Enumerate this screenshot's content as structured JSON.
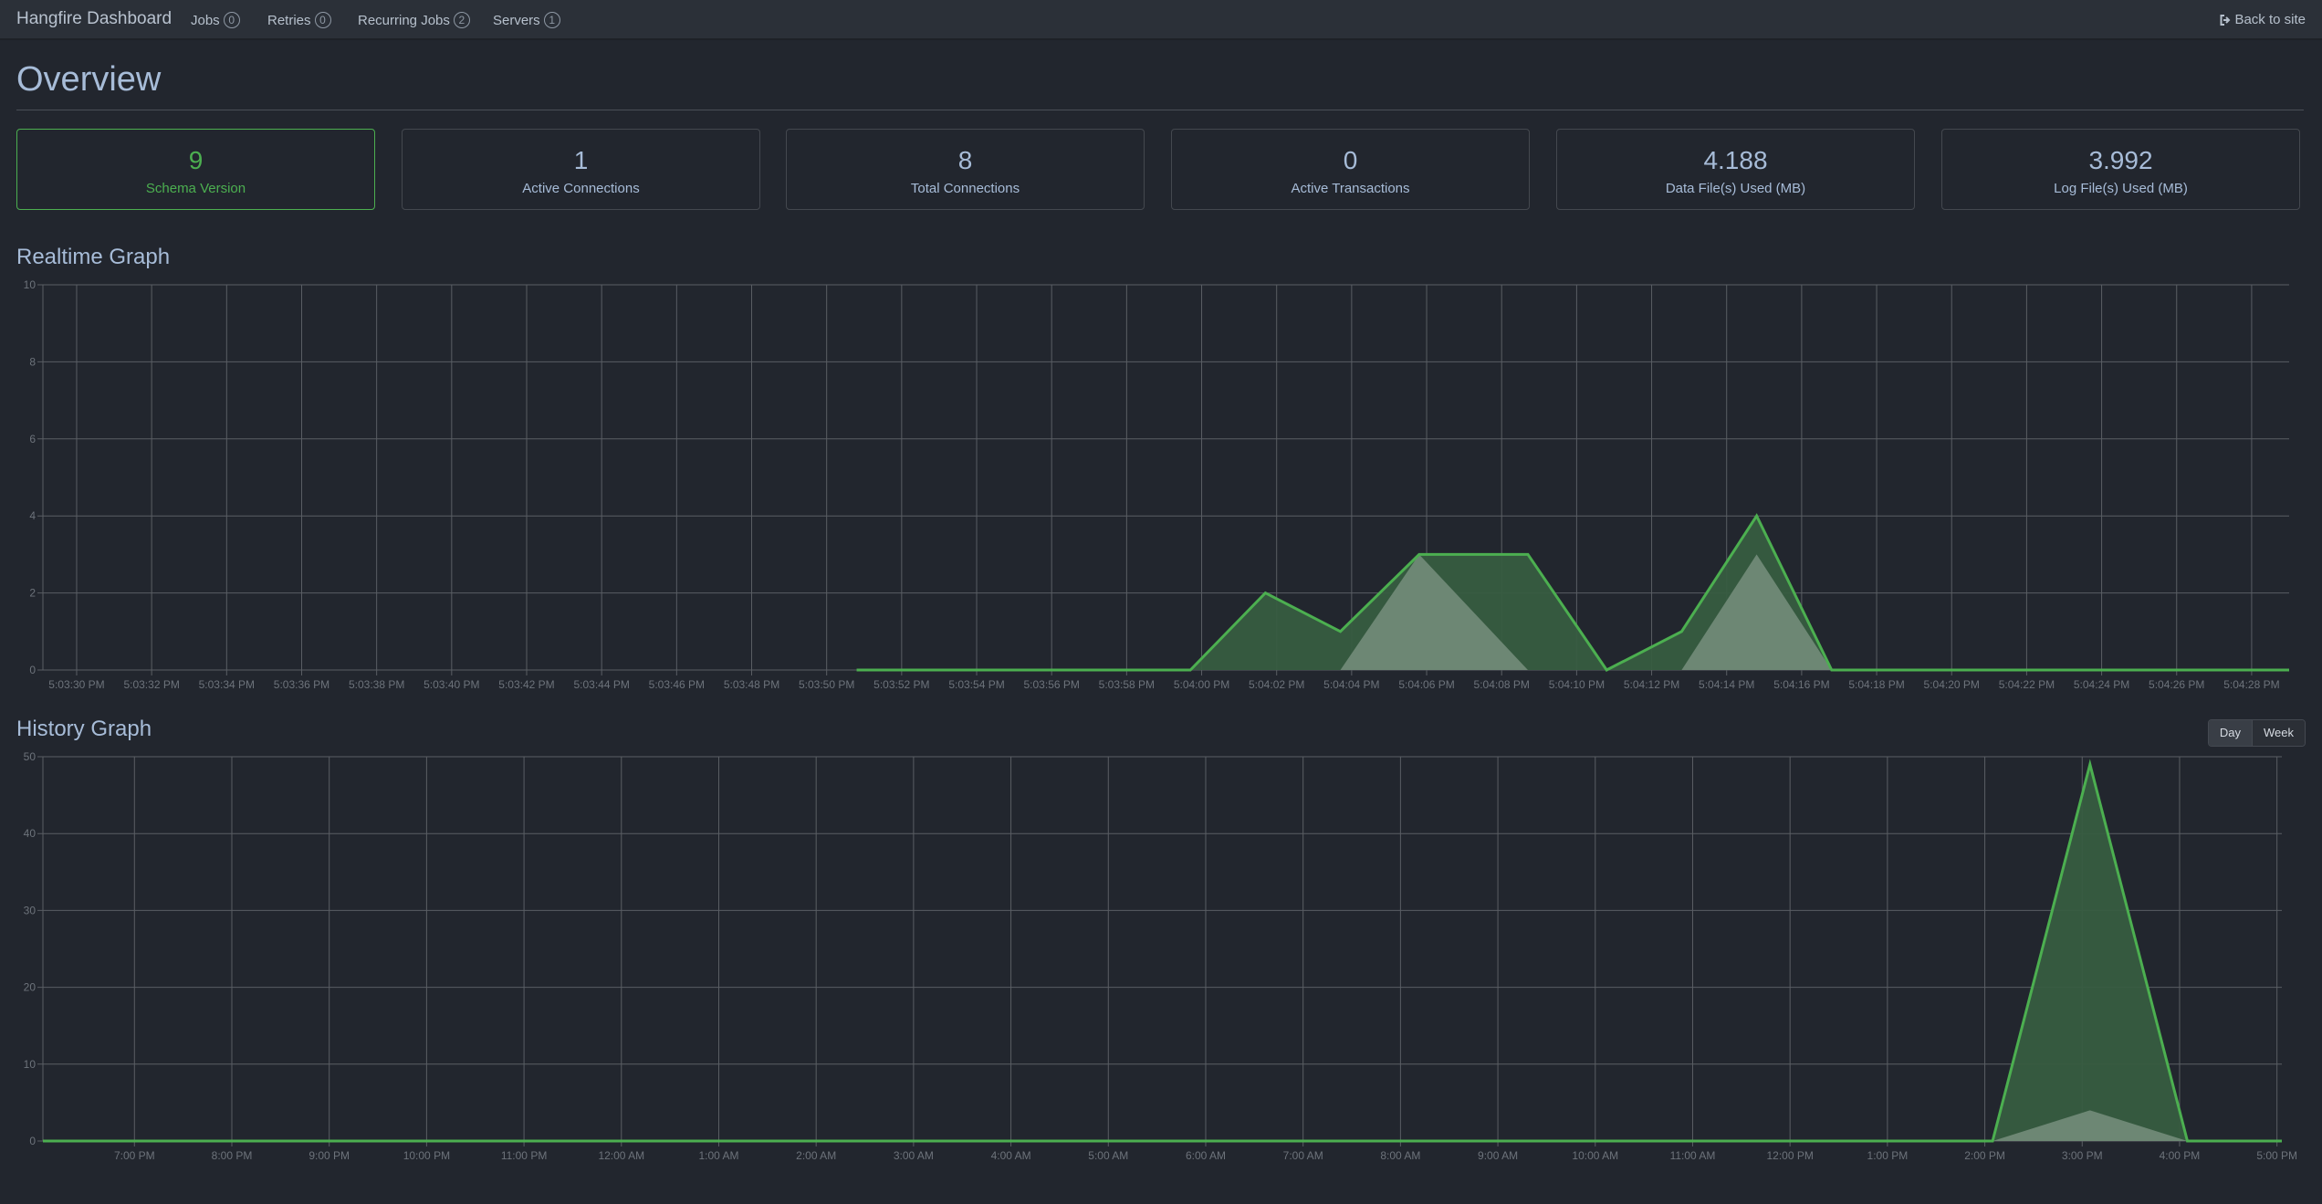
{
  "navbar": {
    "brand": "Hangfire Dashboard",
    "items": [
      {
        "label": "Jobs",
        "count": "0"
      },
      {
        "label": "Retries",
        "count": "0"
      },
      {
        "label": "Recurring Jobs",
        "count": "2"
      },
      {
        "label": "Servers",
        "count": "1"
      }
    ],
    "back_link": {
      "label": "Back to site",
      "icon": "sign-out-icon"
    }
  },
  "page": {
    "title": "Overview"
  },
  "metrics": [
    {
      "value": "9",
      "label": "Schema Version",
      "status": "success"
    },
    {
      "value": "1",
      "label": "Active Connections",
      "status": "default"
    },
    {
      "value": "8",
      "label": "Total Connections",
      "status": "default"
    },
    {
      "value": "0",
      "label": "Active Transactions",
      "status": "default"
    },
    {
      "value": "4.188",
      "label": "Data File(s) Used (MB)",
      "status": "default"
    },
    {
      "value": "3.992",
      "label": "Log File(s) Used (MB)",
      "status": "default"
    }
  ],
  "colors": {
    "accent": "#4caf50",
    "series_fill_primary": "#375c40",
    "series_fill_secondary": "#738c7a",
    "grid": "#5a5e64",
    "background": "#22262e"
  },
  "realtime": {
    "title": "Realtime Graph"
  },
  "history": {
    "title": "History Graph",
    "range_buttons": [
      {
        "label": "Day",
        "active": true
      },
      {
        "label": "Week",
        "active": false
      }
    ]
  },
  "chart_data": [
    {
      "type": "area",
      "title": "Realtime Graph",
      "xlabel": "",
      "ylabel": "",
      "ylim": [
        0,
        10
      ],
      "xlim_seconds_after_5_03_30_PM": [
        -1,
        59
      ],
      "y_ticks": [
        "0",
        "2",
        "4",
        "6",
        "8",
        "10"
      ],
      "x_ticks": [
        "5:03:30 PM",
        "5:03:32 PM",
        "5:03:34 PM",
        "5:03:36 PM",
        "5:03:38 PM",
        "5:03:40 PM",
        "5:03:42 PM",
        "5:03:44 PM",
        "5:03:46 PM",
        "5:03:48 PM",
        "5:03:50 PM",
        "5:03:52 PM",
        "5:03:54 PM",
        "5:03:56 PM",
        "5:03:58 PM",
        "5:04:00 PM",
        "5:04:02 PM",
        "5:04:04 PM",
        "5:04:06 PM",
        "5:04:08 PM",
        "5:04:10 PM",
        "5:04:12 PM",
        "5:04:14 PM",
        "5:04:16 PM",
        "5:04:18 PM",
        "5:04:20 PM",
        "5:04:22 PM",
        "5:04:24 PM",
        "5:04:26 PM",
        "5:04:28 PM"
      ],
      "grid": true,
      "legend": "none",
      "series": [
        {
          "name": "primary",
          "x_seconds": [
            20.8,
            29.7,
            31.7,
            33.7,
            35.8,
            38.7,
            40.8,
            42.8,
            44.8,
            46.8,
            59.0
          ],
          "values": [
            0,
            0,
            2,
            1,
            3,
            3,
            0,
            1,
            4,
            0,
            0
          ]
        },
        {
          "name": "secondary",
          "x_seconds": [
            33.7,
            35.8,
            38.7,
            42.8,
            44.8,
            46.8
          ],
          "values": [
            0,
            3,
            0,
            0,
            3,
            0
          ]
        }
      ]
    },
    {
      "type": "area",
      "title": "History Graph",
      "xlabel": "",
      "ylabel": "",
      "ylim": [
        0,
        50
      ],
      "xlim_hours_after_7_00_PM": [
        -0.94,
        22.05
      ],
      "y_ticks": [
        "0",
        "10",
        "20",
        "30",
        "40",
        "50"
      ],
      "x_ticks": [
        "7:00 PM",
        "8:00 PM",
        "9:00 PM",
        "10:00 PM",
        "11:00 PM",
        "12:00 AM",
        "1:00 AM",
        "2:00 AM",
        "3:00 AM",
        "4:00 AM",
        "5:00 AM",
        "6:00 AM",
        "7:00 AM",
        "8:00 AM",
        "9:00 AM",
        "10:00 AM",
        "11:00 AM",
        "12:00 PM",
        "1:00 PM",
        "2:00 PM",
        "3:00 PM",
        "4:00 PM",
        "5:00 PM"
      ],
      "grid": true,
      "legend": "none",
      "series": [
        {
          "name": "primary",
          "x_hours": [
            -0.94,
            19.08,
            20.08,
            21.08,
            22.05
          ],
          "values": [
            0,
            0,
            49,
            0,
            0
          ]
        },
        {
          "name": "secondary",
          "x_hours": [
            19.08,
            20.08,
            21.08
          ],
          "values": [
            0,
            4,
            0
          ]
        }
      ]
    }
  ]
}
